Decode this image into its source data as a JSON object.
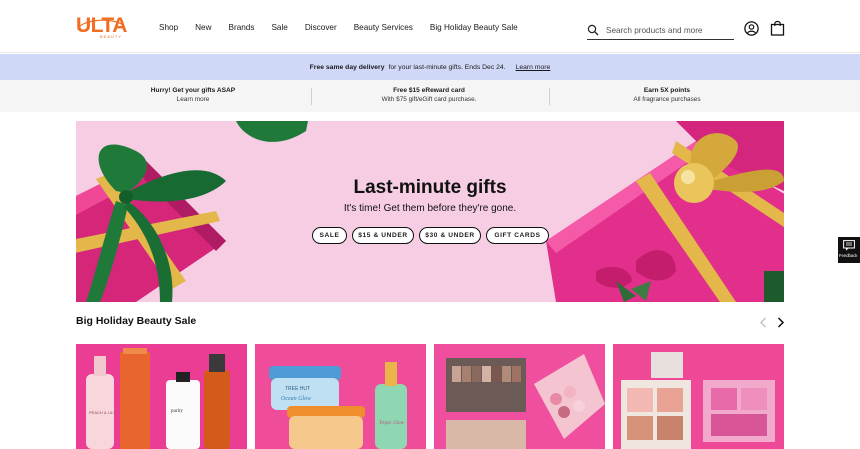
{
  "brand": {
    "logo_text": "ULTA",
    "logo_sub": "BEAUTY",
    "color": "#f26c21"
  },
  "nav": {
    "items": [
      {
        "label": "Shop"
      },
      {
        "label": "New"
      },
      {
        "label": "Brands"
      },
      {
        "label": "Sale"
      },
      {
        "label": "Discover"
      },
      {
        "label": "Beauty Services"
      },
      {
        "label": "Big Holiday Beauty Sale"
      }
    ]
  },
  "search": {
    "placeholder": "Search products and more",
    "icon": "search-icon"
  },
  "header_icons": {
    "account": "account-icon",
    "bag": "bag-icon"
  },
  "promo": {
    "bold": "Free same day delivery",
    "text": "for your last-minute gifts. Ends Dec 24.",
    "link": "Learn more",
    "background": "#d0d8f7"
  },
  "benefits": [
    {
      "title": "Hurry! Get your gifts ASAP",
      "subtitle": "Learn more"
    },
    {
      "title": "Free $15 eReward card",
      "subtitle": "With $75 gift/eGift card purchase."
    },
    {
      "title": "Earn 5X points",
      "subtitle": "All fragrance purchases"
    }
  ],
  "hero": {
    "title": "Last-minute gifts",
    "subtitle": "It's time! Get them before they're gone.",
    "buttons": [
      {
        "label": "SALE"
      },
      {
        "label": "$15 & UNDER"
      },
      {
        "label": "$30 & UNDER"
      },
      {
        "label": "GIFT CARDS"
      }
    ],
    "background": "#f6cde3"
  },
  "feedback": {
    "label": "Feedback",
    "icon": "chat-icon"
  },
  "section": {
    "title": "Big Holiday Beauty Sale",
    "prev_icon": "chevron-left-icon",
    "next_icon": "chevron-right-icon"
  },
  "cards": [
    {
      "name": "skincare-card",
      "texts": {
        "bottle_label_1": "PEACH & LILY",
        "bottle_label_2": "purity"
      }
    },
    {
      "name": "body-scrub-card",
      "texts": {
        "jar_label_1": "TREE HUT",
        "jar_label_2": "Ocean Glow",
        "jar_label_3": "Tropic Glow"
      }
    },
    {
      "name": "eyeshadow-card",
      "texts": {}
    },
    {
      "name": "face-palette-card",
      "texts": {}
    }
  ]
}
